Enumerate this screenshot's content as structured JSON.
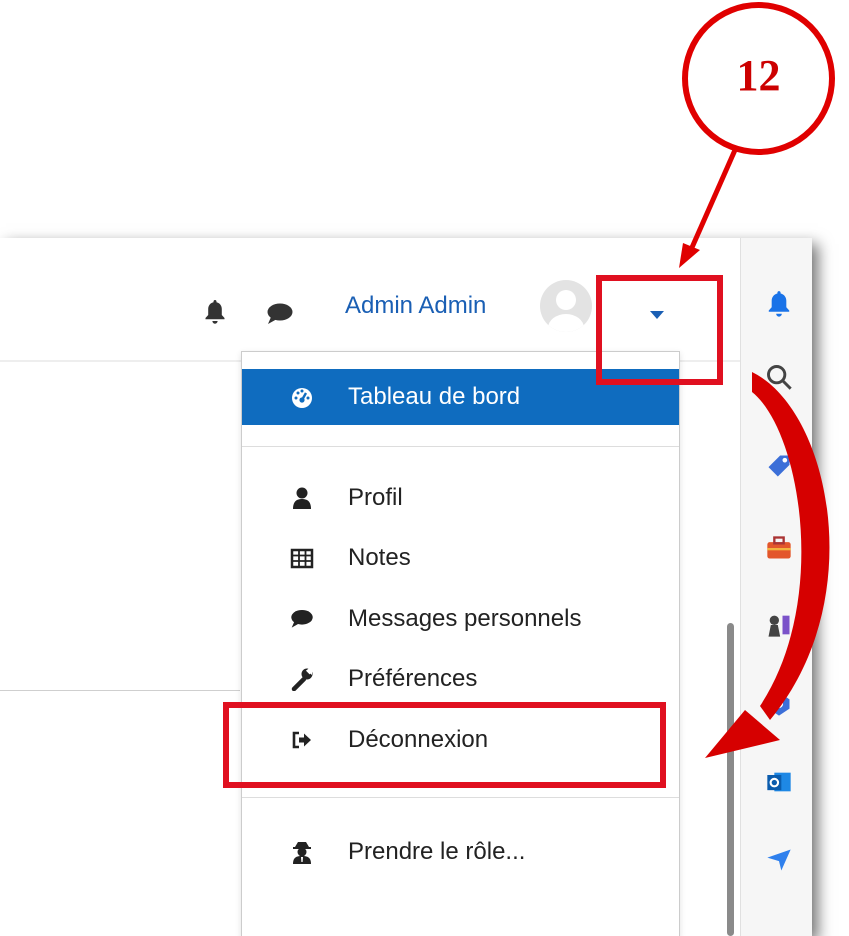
{
  "annotation": {
    "step_number": "12"
  },
  "navbar": {
    "user_name": "Admin Admin",
    "icons": [
      "bell-icon",
      "chat-icon",
      "avatar",
      "caret-down-icon"
    ]
  },
  "menu": {
    "items": [
      {
        "label": "Tableau de bord",
        "icon": "dashboard-icon",
        "active": true
      },
      {
        "label": "Profil",
        "icon": "user-icon"
      },
      {
        "label": "Notes",
        "icon": "table-icon"
      },
      {
        "label": "Messages personnels",
        "icon": "chat-icon"
      },
      {
        "label": "Préférences",
        "icon": "wrench-icon"
      },
      {
        "label": "Déconnexion",
        "icon": "sign-out-icon"
      },
      {
        "label": "Prendre le rôle...",
        "icon": "user-secret-icon"
      }
    ]
  },
  "browser_sidebar": {
    "icons": [
      "bell-icon",
      "search-icon",
      "tag-icon",
      "briefcase-icon",
      "chess-icon",
      "copilot-icon",
      "outlook-icon",
      "send-icon"
    ]
  },
  "colors": {
    "active_item_bg": "#0f6cbf",
    "link_blue": "#1a5fb4",
    "annotation_red": "#e00000"
  }
}
